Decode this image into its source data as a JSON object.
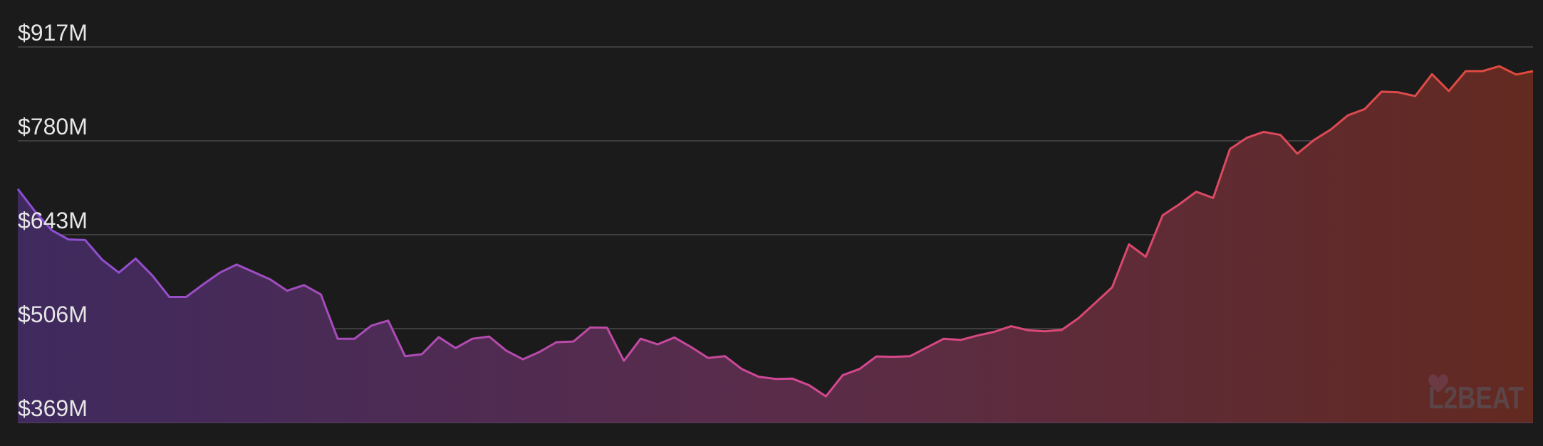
{
  "colors": {
    "background": "#1b1b1b",
    "grid": "#4a4a4a",
    "tick_text": "#e6e6e6",
    "line_start": "#8a4fd6",
    "line_mid": "#d6478f",
    "line_end": "#e04a3a",
    "fill_start": "#3f2a5e",
    "fill_mid": "#5a2c4a",
    "fill_end": "#632a20"
  },
  "watermark": {
    "text": "L2BEAT",
    "icon": "heart-icon"
  },
  "chart_data": {
    "type": "area",
    "title": "",
    "xlabel": "",
    "ylabel": "",
    "ylim": [
      369,
      917
    ],
    "y_ticks": [
      {
        "value": 917,
        "label": "$917M"
      },
      {
        "value": 780,
        "label": "$780M"
      },
      {
        "value": 643,
        "label": "$643M"
      },
      {
        "value": 506,
        "label": "$506M"
      },
      {
        "value": 369,
        "label": "$369M"
      }
    ],
    "grid": true,
    "legend": "none",
    "values": [
      709.7,
      677.8,
      649.9,
      636.2,
      635.3,
      606.8,
      587.7,
      608.2,
      583.2,
      552.2,
      552.2,
      570.5,
      587.7,
      599.5,
      588.6,
      577.7,
      561.3,
      569.5,
      555.9,
      491.3,
      491.3,
      510.4,
      517.7,
      465.8,
      468.6,
      493.6,
      477.7,
      491.3,
      494.5,
      474.0,
      461.3,
      472.2,
      486.3,
      487.2,
      507.7,
      507.2,
      459.0,
      491.3,
      483.1,
      493.1,
      479.0,
      463.1,
      465.8,
      447.2,
      435.8,
      432.6,
      433.1,
      423.5,
      407.2,
      438.1,
      447.2,
      465.4,
      464.9,
      465.8,
      478.6,
      491.3,
      489.5,
      495.9,
      501.3,
      509.5,
      503.6,
      502.2,
      504.0,
      521.3,
      543.6,
      566.3,
      629.0,
      610.8,
      671.3,
      687.6,
      705.8,
      696.7,
      768.1,
      784.5,
      793.1,
      788.6,
      761.3,
      781.3,
      796.7,
      817.2,
      826.3,
      851.7,
      850.8,
      845.3,
      877.2,
      852.6,
      881.7,
      881.7,
      888.9,
      876.7,
      881.7
    ]
  }
}
